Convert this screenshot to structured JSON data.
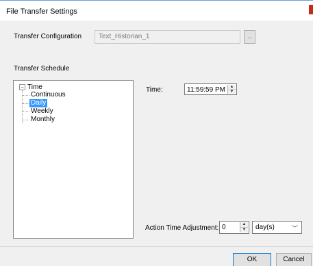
{
  "window": {
    "title": "File Transfer Settings"
  },
  "transfer_configuration": {
    "label": "Transfer Configuration",
    "value": "Text_Historian_1",
    "browse_label": ".."
  },
  "transfer_schedule": {
    "label": "Transfer Schedule",
    "tree": {
      "root": {
        "label": "Time",
        "expander": "−"
      },
      "items": [
        {
          "label": "Continuous"
        },
        {
          "label": "Daily",
          "selected": true
        },
        {
          "label": "Weekly"
        },
        {
          "label": "Monthly"
        }
      ]
    }
  },
  "time": {
    "label": "Time:",
    "value": "11:59:59 PM"
  },
  "action_time_adjustment": {
    "label": "Action Time Adjustment:",
    "value": "0",
    "unit": "day(s)"
  },
  "buttons": {
    "ok": "OK",
    "cancel": "Cancel"
  },
  "colors": {
    "selection": "#3399ff",
    "close_accent": "#c42b1c",
    "title_border": "#6aa0d8"
  },
  "icons": {
    "expander": "minus-box-icon",
    "spin_up": "triangle-up-icon",
    "spin_down": "triangle-down-icon",
    "dropdown": "chevron-down-icon"
  }
}
